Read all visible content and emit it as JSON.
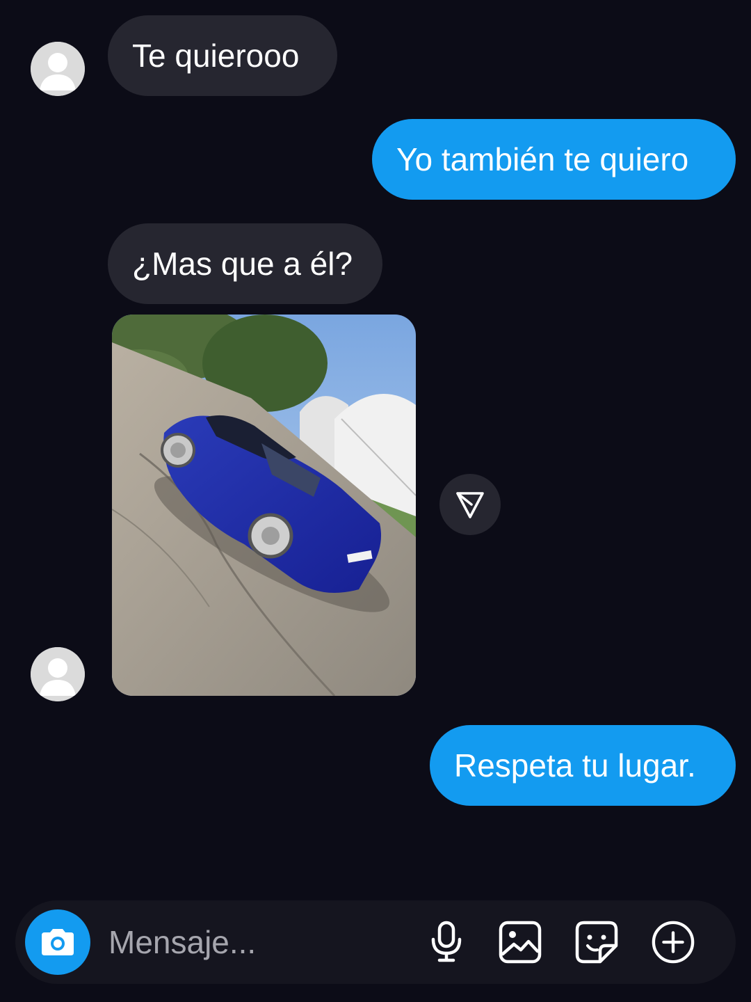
{
  "messages": [
    {
      "sender": "other",
      "text": "Te quierooo"
    },
    {
      "sender": "me",
      "text": "Yo también te quiero"
    },
    {
      "sender": "other",
      "text": "¿Mas que a él?"
    },
    {
      "sender": "other",
      "type": "image",
      "alt": "blue car parked on asphalt"
    },
    {
      "sender": "me",
      "text": "Respeta tu lugar."
    }
  ],
  "composer": {
    "placeholder": "Mensaje...",
    "icons": [
      "camera-icon",
      "microphone-icon",
      "gallery-icon",
      "sticker-icon",
      "add-icon"
    ]
  },
  "colors": {
    "background": "#0c0c17",
    "incoming_bubble": "#262630",
    "outgoing_bubble": "#139bf0",
    "accent": "#139bf0"
  }
}
